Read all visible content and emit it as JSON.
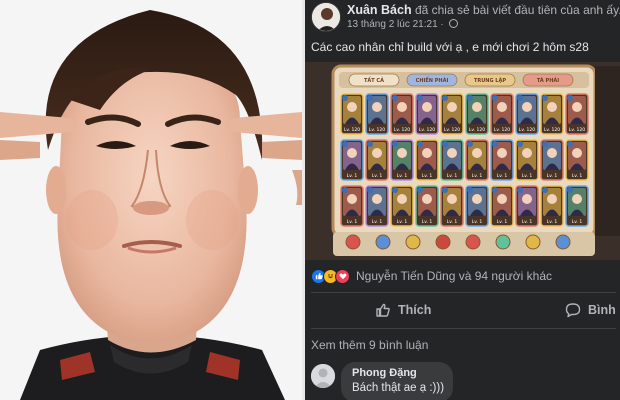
{
  "post": {
    "author": "Xuân Bách",
    "action": "đã chia sẻ bài viết đầu tiên của anh ấy.",
    "timestamp": "13 tháng 2 lúc 21:21",
    "privacy": "globe-icon",
    "text": "Các cao nhân chỉ build với ạ , e mới chơi 2 hôm s28"
  },
  "game": {
    "tabs": [
      "TẤT CẢ",
      "CHIẾN PHÁI",
      "TRUNG LẬP",
      "TÀ PHÁI"
    ],
    "levels_row1": [
      "Lv. 120",
      "Lv. 120",
      "Lv. 120",
      "Lv. 120",
      "Lv. 120",
      "Lv. 120",
      "Lv. 120",
      "Lv. 120",
      "Lv. 120",
      "Lv. 120"
    ],
    "levels_row2": [
      "Lv. 1",
      "Lv. 1",
      "Lv. 1",
      "Lv. 1",
      "Lv. 1",
      "Lv. 1",
      "Lv. 1",
      "Lv. 1",
      "Lv. 1",
      "Lv. 1"
    ],
    "levels_row3": [
      "Lv. 1",
      "Lv. 1",
      "Lv. 1",
      "Lv. 1",
      "Lv. 1",
      "Lv. 1",
      "Lv. 1",
      "Lv. 1",
      "Lv. 1",
      "Lv. 1"
    ],
    "bottom_menu": [
      "",
      "",
      "",
      "",
      "",
      "",
      "",
      ""
    ]
  },
  "reactions": {
    "icons": [
      "like-icon",
      "haha-icon",
      "love-icon"
    ],
    "summary": "Nguyễn Tiến Dũng và 94 người khác"
  },
  "actions": {
    "like_label": "Thích",
    "comment_label": "Bình lu"
  },
  "comments": {
    "more_label": "Xem thêm 9 bình luận",
    "items": [
      {
        "author": "Phong Đặng",
        "text": "Bách thật ae ạ :)))"
      }
    ]
  },
  "colors": {
    "panel_bg": "#242526",
    "text_primary": "#e4e6eb",
    "text_secondary": "#b0b3b8",
    "like_blue": "#1877f2",
    "comment_bubble": "#3a3b3c"
  }
}
